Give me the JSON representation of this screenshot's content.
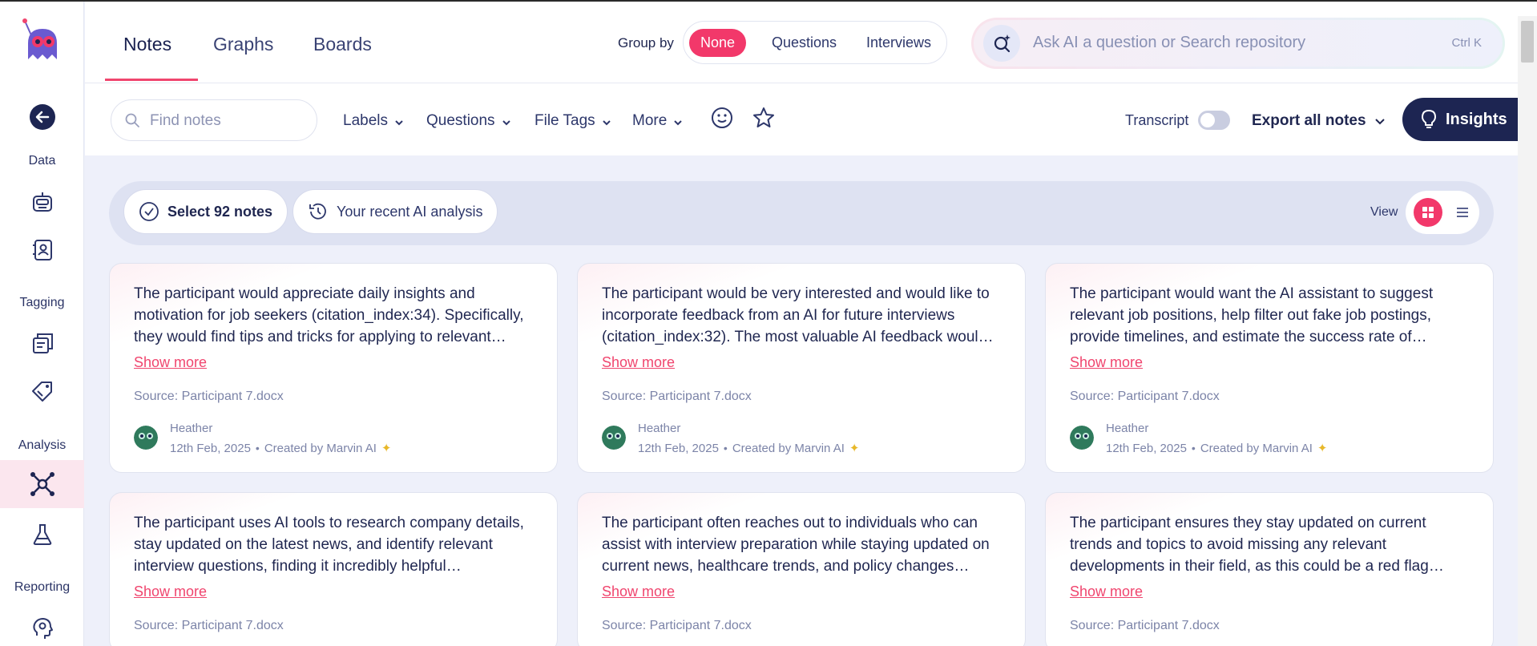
{
  "header": {
    "tabs": [
      {
        "label": "Notes"
      },
      {
        "label": "Graphs"
      },
      {
        "label": "Boards"
      }
    ],
    "group_by": {
      "label": "Group by",
      "options": [
        "None",
        "Questions",
        "Interviews"
      ],
      "selected": "None"
    },
    "ai_search": {
      "placeholder": "Ask AI a question or Search repository",
      "shortcut": "Ctrl K"
    }
  },
  "sidebar": {
    "sections": [
      {
        "label": "Data"
      },
      {
        "label": "Tagging"
      },
      {
        "label": "Analysis"
      },
      {
        "label": "Reporting"
      }
    ],
    "icons": [
      "back-arrow-icon",
      "robot-icon",
      "contacts-book-icon",
      "stacked-notes-icon",
      "tags-icon",
      "analysis-network-icon",
      "flask-icon",
      "lightbulb-head-icon"
    ],
    "active": "analysis-network-icon"
  },
  "toolbar": {
    "find_placeholder": "Find notes",
    "filters": [
      "Labels",
      "Questions",
      "File Tags",
      "More"
    ],
    "transcript_label": "Transcript",
    "transcript_on": false,
    "export_label": "Export all notes",
    "insights_label": "Insights"
  },
  "selection_bar": {
    "select_label": "Select 92 notes",
    "recent_label": "Your recent AI analysis",
    "view_label": "View",
    "view_mode": "grid"
  },
  "colors": {
    "accent": "#f2386a",
    "navy": "#1d2552",
    "bg": "#eef0fa"
  },
  "cards": [
    {
      "text": "The participant would appreciate daily insights and motivation for job seekers (citation_index:34). Specifically, they would find tips and tricks for applying to relevant…",
      "show_more": "Show more",
      "source": "Source: Participant 7.docx",
      "author": "Heather",
      "date": "12th Feb, 2025",
      "created_by": "Created by Marvin AI"
    },
    {
      "text": "The participant would be very interested and would like to incorporate feedback from an AI for future interviews (citation_index:32). The most valuable AI feedback woul…",
      "show_more": "Show more",
      "source": "Source: Participant 7.docx",
      "author": "Heather",
      "date": "12th Feb, 2025",
      "created_by": "Created by Marvin AI"
    },
    {
      "text": "The participant would want the AI assistant to suggest relevant job positions, help filter out fake job postings, provide timelines, and estimate the success rate of…",
      "show_more": "Show more",
      "source": "Source: Participant 7.docx",
      "author": "Heather",
      "date": "12th Feb, 2025",
      "created_by": "Created by Marvin AI"
    },
    {
      "text": "The participant uses AI tools to research company details, stay updated on the latest news, and identify relevant interview questions, finding it incredibly helpful…",
      "show_more": "Show more",
      "source": "Source: Participant 7.docx"
    },
    {
      "text": "The participant often reaches out to individuals who can assist with interview preparation while staying updated on current news, healthcare trends, and policy changes…",
      "show_more": "Show more",
      "source": "Source: Participant 7.docx"
    },
    {
      "text": "The participant ensures they stay updated on current trends and topics to avoid missing any relevant developments in their field, as this could be a red flag…",
      "show_more": "Show more",
      "source": "Source: Participant 7.docx"
    }
  ]
}
